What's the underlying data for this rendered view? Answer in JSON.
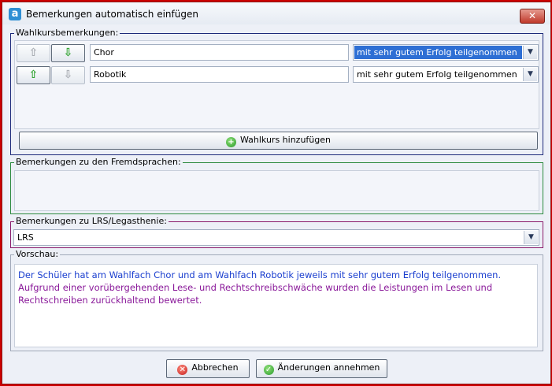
{
  "window": {
    "title": "Bemerkungen automatisch einfügen",
    "app_icon_letter": "a",
    "close_label": "✕"
  },
  "wahlkurs": {
    "label": "Wahlkursbemerkungen:",
    "rows": [
      {
        "course": "Chor",
        "result": "mit sehr gutem Erfolg teilgenommen",
        "up_enabled": false,
        "down_enabled": true
      },
      {
        "course": "Robotik",
        "result": "mit sehr gutem Erfolg teilgenommen",
        "up_enabled": true,
        "down_enabled": false
      }
    ],
    "add_button": "Wahlkurs hinzufügen"
  },
  "fremdsprachen": {
    "label": "Bemerkungen zu den Fremdsprachen:"
  },
  "lrs": {
    "label": "Bemerkungen zu LRS/Legasthenie:",
    "value": "LRS"
  },
  "vorschau": {
    "label": "Vorschau:",
    "text_blue": "Der Schüler hat am Wahlfach Chor und am Wahlfach Robotik jeweils mit sehr gutem Erfolg teilgenommen.",
    "text_purple": " Aufgrund einer vorübergehenden Lese- und Rechtschreibschwäche wurden die Leistungen im Lesen und Rechtschreiben zurückhaltend bewertet."
  },
  "footer": {
    "cancel": "Abbrechen",
    "accept": "Änderungen annehmen"
  },
  "icons": {
    "up": "⇧",
    "down": "⇩",
    "dropdown": "▼",
    "plus": "+",
    "cross": "✕",
    "check": "✓"
  },
  "colors": {
    "selected_bg": "#2e6fd4",
    "preview_blue": "#1b3fcf",
    "preview_purple": "#8a1a9a",
    "border": "#cc0000"
  }
}
